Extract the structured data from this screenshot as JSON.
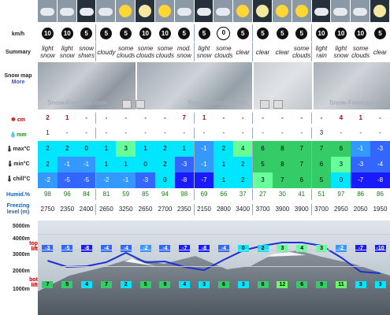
{
  "labels": {
    "wind": "km/h",
    "summary": "Summary",
    "snow_map": "Snow map",
    "more": "More",
    "snow_cm": "cm",
    "rain_mm": "mm",
    "max_c": "max°C",
    "min_c": "min°C",
    "chill_c": "chill°C",
    "humid": "Humid.%",
    "freezing": "Freezing level (m)",
    "alt5000": "5000m",
    "alt4000": "4000m",
    "alt3000": "3000m",
    "alt2000": "2000m",
    "alt1000": "1000m",
    "top_lift": "top lift",
    "bot_lift": "bot lift",
    "watermark": "Snow-Forecast.com"
  },
  "wind": [
    "10",
    "10",
    "5",
    "5",
    "5",
    "10",
    "10",
    "5",
    "5",
    "0",
    "5",
    "5",
    "5",
    "5",
    "10",
    "10",
    "10",
    "5"
  ],
  "summary": [
    "light snow",
    "light snow",
    "snow shwrs",
    "cloudy",
    "some clouds",
    "some clouds",
    "some clouds",
    "mod. snow",
    "light snow",
    "some clouds",
    "clear",
    "clear",
    "clear",
    "some clouds",
    "light rain",
    "light snow",
    "some clouds",
    "clear"
  ],
  "snow": [
    "2",
    "1",
    "-",
    "-",
    "-",
    "-",
    "-",
    "7",
    "1",
    "-",
    "-",
    "-",
    "-",
    "-",
    "-",
    "4",
    "1",
    "-"
  ],
  "rain": [
    "1",
    "-",
    "-",
    "-",
    "-",
    "-",
    "-",
    "-",
    "-",
    "-",
    "-",
    "-",
    "-",
    "-",
    "3",
    "-",
    "-",
    "-"
  ],
  "max": [
    "2",
    "2",
    "0",
    "1",
    "3",
    "1",
    "2",
    "1",
    "-1",
    "2",
    "4",
    "6",
    "8",
    "7",
    "7",
    "6",
    "-1",
    "-3"
  ],
  "min": [
    "2",
    "-1",
    "-1",
    "1",
    "1",
    "0",
    "2",
    "-3",
    "-1",
    "1",
    "2",
    "5",
    "8",
    "7",
    "6",
    "3",
    "-3",
    "-4"
  ],
  "chill": [
    "-2",
    "-5",
    "-5",
    "-2",
    "-1",
    "-3",
    "0",
    "-8",
    "-7",
    "1",
    "2",
    "3",
    "7",
    "6",
    "5",
    "0",
    "-7",
    "-8"
  ],
  "humid": [
    "98",
    "96",
    "84",
    "81",
    "59",
    "85",
    "94",
    "98",
    "69",
    "66",
    "37",
    "27",
    "30",
    "41",
    "51",
    "97",
    "86",
    "86"
  ],
  "freezing": [
    "2750",
    "2350",
    "2400",
    "2650",
    "3250",
    "2650",
    "2700",
    "2350",
    "2150",
    "2800",
    "3400",
    "3700",
    "3900",
    "3900",
    "3700",
    "2950",
    "2050",
    "1950"
  ],
  "top": [
    "-3",
    "-5",
    "-8",
    "-4",
    "-4",
    "-2",
    "-4",
    "-7",
    "-8",
    "-4",
    "0",
    "2",
    "3",
    "4",
    "3",
    "-2",
    "-7",
    "-10"
  ],
  "bot": [
    "7",
    "5",
    "4",
    "7",
    "2",
    "5",
    "9",
    "4",
    "3",
    "6",
    "3",
    "6",
    "12",
    "6",
    "9",
    "11",
    "3",
    "3"
  ],
  "colors": {
    "cyan": "#00e6ff",
    "blue_dark": "#1a1aff",
    "blue_mid": "#3366ff",
    "green": "#33cc66",
    "light_green": "#66ff66",
    "red": "#c00000"
  }
}
